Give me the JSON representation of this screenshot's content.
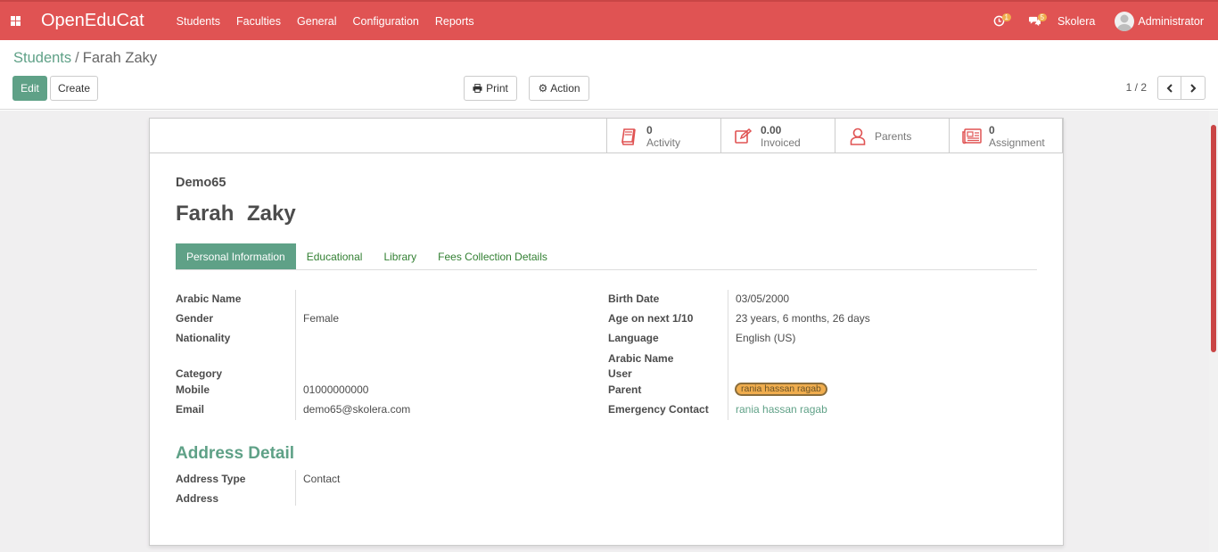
{
  "navbar": {
    "brand": "OpenEduCat",
    "menu": [
      "Students",
      "Faculties",
      "General",
      "Configuration",
      "Reports"
    ],
    "activity_badge": "1",
    "message_badge": "5",
    "company": "Skolera",
    "user": "Administrator",
    "color": "#e05353"
  },
  "control": {
    "breadcrumb_parent": "Students",
    "breadcrumb_sep": "/",
    "breadcrumb_current": "Farah Zaky",
    "edit_label": "Edit",
    "create_label": "Create",
    "print_label": "Print",
    "action_label": "Action",
    "pager": "1 / 2"
  },
  "stats": [
    {
      "value": "0",
      "label": "Activity",
      "icon": "book-icon"
    },
    {
      "value": "0.00",
      "label": "Invoiced",
      "icon": "edit-icon"
    },
    {
      "value": "",
      "label": "Parents",
      "icon": "user-icon"
    },
    {
      "value": "0",
      "label": "Assignment",
      "icon": "newspaper-icon"
    }
  ],
  "record": {
    "ref": "Demo65",
    "name": "Farah Zaky"
  },
  "tabs": [
    "Personal Information",
    "Educational",
    "Library",
    "Fees Collection Details"
  ],
  "left_fields": {
    "arabic_name_label": "Arabic Name",
    "gender_label": "Gender",
    "gender": "Female",
    "nationality_label": "Nationality",
    "category_label": "Category",
    "mobile_label": "Mobile",
    "mobile": "01000000000",
    "email_label": "Email",
    "email": "demo65@skolera.com"
  },
  "right_fields": {
    "birth_date_label": "Birth Date",
    "birth_date": "03/05/2000",
    "age_label": "Age on next 1/10",
    "age": "23 years, 6 months, 26 days",
    "language_label": "Language",
    "language": "English (US)",
    "arabic_name_label": "Arabic Name",
    "user_label": "User",
    "parent_label": "Parent",
    "parent": "rania hassan ragab",
    "emergency_label": "Emergency Contact",
    "emergency": "rania hassan ragab"
  },
  "address": {
    "section_title": "Address Detail",
    "type_label": "Address Type",
    "type": "Contact",
    "address_label": "Address"
  }
}
